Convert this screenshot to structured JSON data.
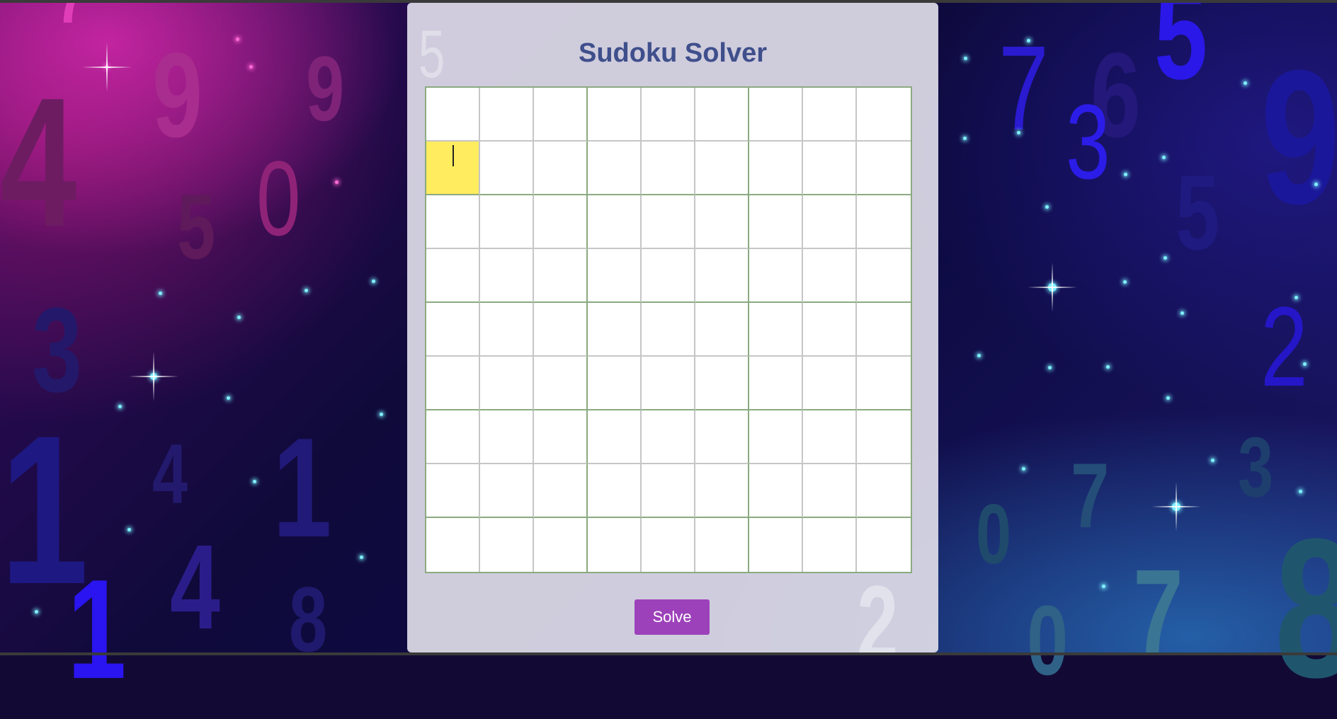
{
  "app": {
    "title": "Sudoku Solver",
    "solve_label": "Solve",
    "accent_color": "#9d41ba",
    "title_color": "#3f4f8c",
    "active_cell_color": "#ffec5f"
  },
  "grid": {
    "size": 9,
    "box_size": 3,
    "active_cell": {
      "row": 1,
      "col": 0
    },
    "cells": [
      [
        "",
        "",
        "",
        "",
        "",
        "",
        "",
        "",
        ""
      ],
      [
        "",
        "",
        "",
        "",
        "",
        "",
        "",
        "",
        ""
      ],
      [
        "",
        "",
        "",
        "",
        "",
        "",
        "",
        "",
        ""
      ],
      [
        "",
        "",
        "",
        "",
        "",
        "",
        "",
        "",
        ""
      ],
      [
        "",
        "",
        "",
        "",
        "",
        "",
        "",
        "",
        ""
      ],
      [
        "",
        "",
        "",
        "",
        "",
        "",
        "",
        "",
        ""
      ],
      [
        "",
        "",
        "",
        "",
        "",
        "",
        "",
        "",
        ""
      ],
      [
        "",
        "",
        "",
        "",
        "",
        "",
        "",
        "",
        ""
      ],
      [
        "",
        "",
        "",
        "",
        "",
        "",
        "",
        "",
        ""
      ]
    ]
  }
}
